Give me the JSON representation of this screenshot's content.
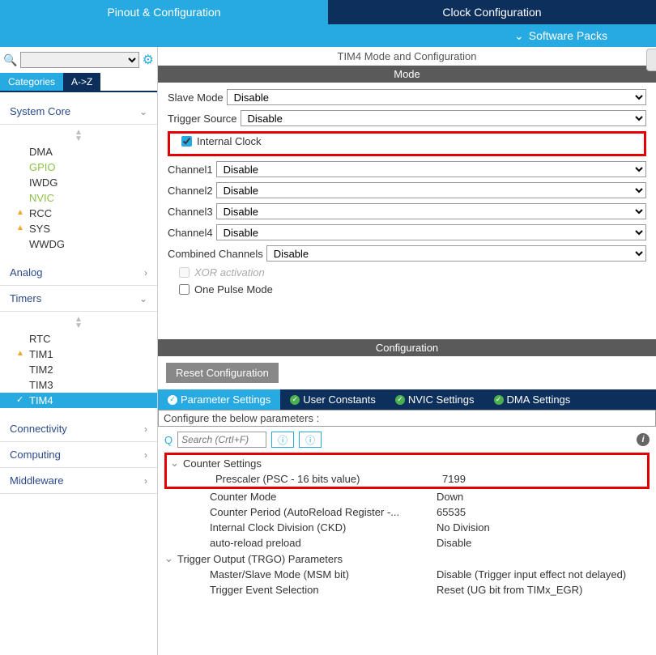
{
  "topTabs": {
    "pinout": "Pinout & Configuration",
    "clock": "Clock Configuration"
  },
  "subBar": {
    "label": "Software Packs"
  },
  "sidebar": {
    "catTabs": {
      "categories": "Categories",
      "az": "A->Z"
    },
    "groups": {
      "systemCore": {
        "label": "System Core",
        "items": [
          {
            "label": "DMA"
          },
          {
            "label": "GPIO",
            "cls": "green"
          },
          {
            "label": "IWDG"
          },
          {
            "label": "NVIC",
            "cls": "green"
          },
          {
            "label": "RCC",
            "cls": "warn"
          },
          {
            "label": "SYS",
            "cls": "warn"
          },
          {
            "label": "WWDG"
          }
        ]
      },
      "analog": {
        "label": "Analog"
      },
      "timers": {
        "label": "Timers",
        "items": [
          {
            "label": "RTC"
          },
          {
            "label": "TIM1",
            "cls": "warn"
          },
          {
            "label": "TIM2"
          },
          {
            "label": "TIM3"
          },
          {
            "label": "TIM4",
            "cls": "sel"
          }
        ]
      },
      "connectivity": {
        "label": "Connectivity"
      },
      "computing": {
        "label": "Computing"
      },
      "middleware": {
        "label": "Middleware"
      }
    }
  },
  "panel": {
    "title": "TIM4 Mode and Configuration",
    "modeHeader": "Mode",
    "mode": {
      "slaveMode": {
        "label": "Slave Mode",
        "value": "Disable"
      },
      "triggerSource": {
        "label": "Trigger Source",
        "value": "Disable"
      },
      "internalClock": {
        "label": "Internal Clock"
      },
      "channel1": {
        "label": "Channel1",
        "value": "Disable"
      },
      "channel2": {
        "label": "Channel2",
        "value": "Disable"
      },
      "channel3": {
        "label": "Channel3",
        "value": "Disable"
      },
      "channel4": {
        "label": "Channel4",
        "value": "Disable"
      },
      "combined": {
        "label": "Combined Channels",
        "value": "Disable"
      },
      "xor": {
        "label": "XOR activation"
      },
      "onePulse": {
        "label": "One Pulse Mode"
      }
    },
    "configHeader": "Configuration",
    "reset": "Reset Configuration",
    "cfgTabs": {
      "param": "Parameter Settings",
      "user": "User Constants",
      "nvic": "NVIC Settings",
      "dma": "DMA Settings"
    },
    "paramsHeader": "Configure the below parameters :",
    "searchPlaceholder": "Search (CrtI+F)",
    "groups": {
      "counter": {
        "label": "Counter Settings",
        "prescaler": {
          "name": "Prescaler (PSC - 16 bits value)",
          "value": "7199"
        },
        "counterMode": {
          "name": "Counter Mode",
          "value": "Down"
        },
        "period": {
          "name": "Counter Period (AutoReload Register -...",
          "value": "65535"
        },
        "ckd": {
          "name": "Internal Clock Division (CKD)",
          "value": "No Division"
        },
        "preload": {
          "name": "auto-reload preload",
          "value": "Disable"
        }
      },
      "trgo": {
        "label": "Trigger Output (TRGO) Parameters",
        "msm": {
          "name": "Master/Slave Mode (MSM bit)",
          "value": "Disable (Trigger input effect not delayed)"
        },
        "trgEvt": {
          "name": "Trigger Event Selection",
          "value": "Reset (UG bit from TIMx_EGR)"
        }
      }
    }
  }
}
